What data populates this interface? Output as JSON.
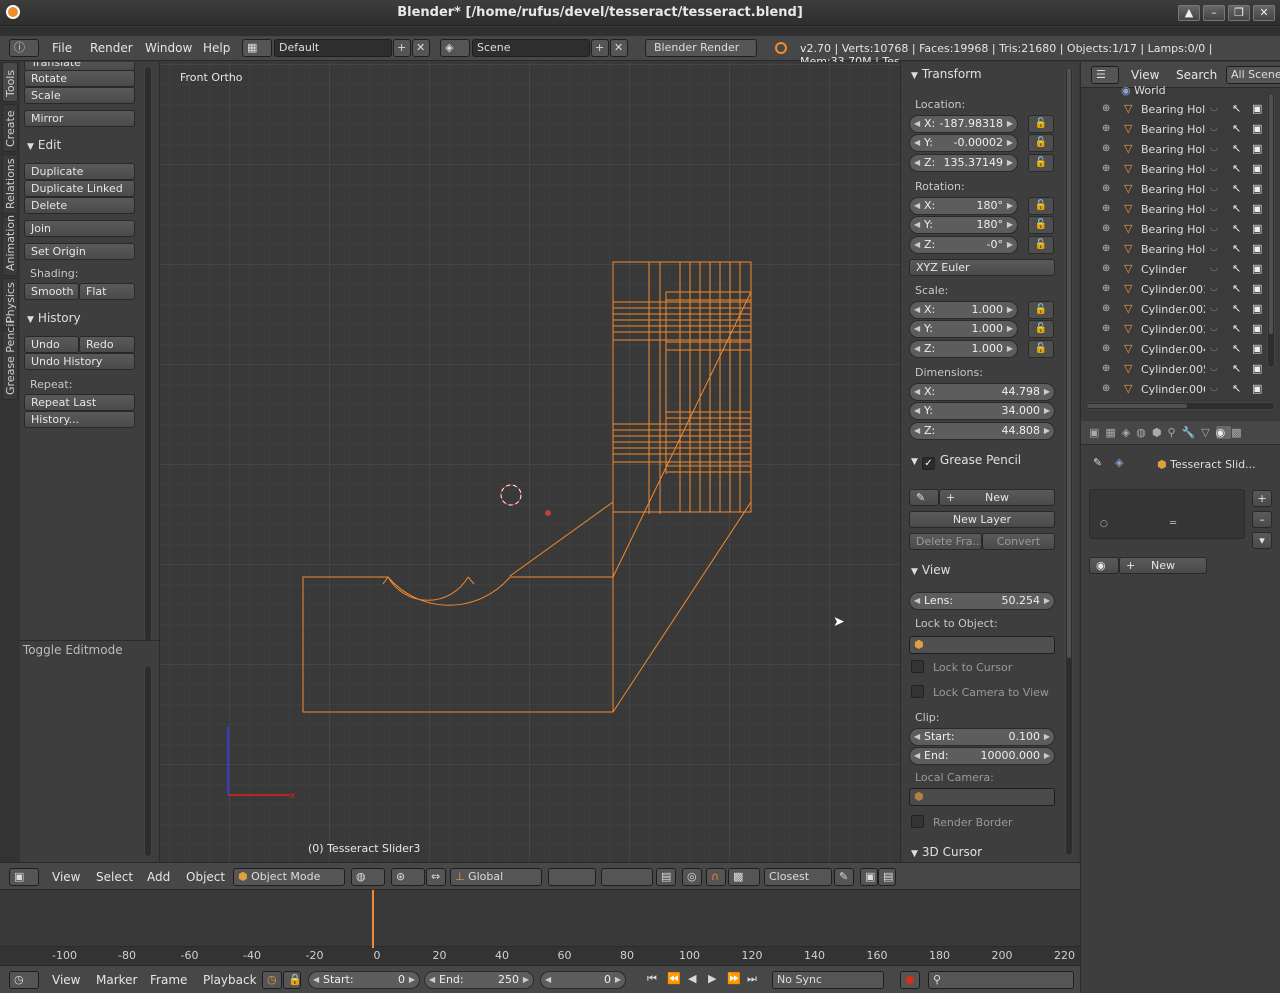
{
  "window": {
    "title": "Blender* [/home/rufus/devel/tesseract/tesseract.blend]"
  },
  "menubar": {
    "menus": [
      "File",
      "Render",
      "Window",
      "Help"
    ],
    "layout": "Default",
    "scene": "Scene",
    "engine": "Blender Render",
    "stats": "v2.70 | Verts:10768 | Faces:19968 | Tris:21680 | Objects:1/17 | Lamps:0/0 | Mem:33.70M | Tes"
  },
  "tool_tabs": [
    "Tools",
    "Create",
    "Relations",
    "Animation",
    "Physics",
    "Grease Pencil"
  ],
  "tools": {
    "partial_top": "Translate",
    "rotate": "Rotate",
    "scale": "Scale",
    "mirror": "Mirror",
    "edit_header": "Edit",
    "duplicate": "Duplicate",
    "duplicate_linked": "Duplicate Linked",
    "delete": "Delete",
    "join": "Join",
    "set_origin": "Set Origin",
    "shading_label": "Shading:",
    "smooth": "Smooth",
    "flat": "Flat",
    "history_header": "History",
    "undo": "Undo",
    "redo": "Redo",
    "undo_history": "Undo History",
    "repeat_label": "Repeat:",
    "repeat_last": "Repeat Last",
    "history": "History...",
    "toggle_editmode": "Toggle Editmode"
  },
  "viewport": {
    "view_name": "Front Ortho",
    "object_info": "(0) Tesseract Slider3"
  },
  "properties": {
    "transform_header": "Transform",
    "location_label": "Location:",
    "location": {
      "x": "-187.98318",
      "y": "-0.00002",
      "z": "135.37149"
    },
    "rotation_label": "Rotation:",
    "rotation": {
      "x": "180°",
      "y": "180°",
      "z": "-0°"
    },
    "rotation_mode": "XYZ Euler",
    "scale_label": "Scale:",
    "scale": {
      "x": "1.000",
      "y": "1.000",
      "z": "1.000"
    },
    "dimensions_label": "Dimensions:",
    "dimensions": {
      "x": "44.798",
      "y": "34.000",
      "z": "44.808"
    },
    "grease_pencil_header": "Grease Pencil",
    "gp_new": "New",
    "gp_new_layer": "New Layer",
    "gp_delete_frame": "Delete Fra...",
    "gp_convert": "Convert",
    "view_header": "View",
    "lens_label": "Lens:",
    "lens": "50.254",
    "lock_to_object": "Lock to Object:",
    "lock_to_cursor": "Lock to Cursor",
    "lock_camera": "Lock Camera to View",
    "clip_label": "Clip:",
    "clip_start_label": "Start:",
    "clip_start": "0.100",
    "clip_end_label": "End:",
    "clip_end": "10000.000",
    "local_camera": "Local Camera:",
    "render_border": "Render Border",
    "cursor_header": "3D Cursor",
    "axis_labels": {
      "x": "X:",
      "y": "Y:",
      "z": "Z:"
    }
  },
  "outliner": {
    "menus": [
      "View",
      "Search"
    ],
    "filter": "All Scenes",
    "partial_top": "World",
    "items": [
      "Bearing Holc",
      "Bearing Holc",
      "Bearing Holc",
      "Bearing Holc",
      "Bearing Holc",
      "Bearing Holc",
      "Bearing Holc",
      "Bearing Holc",
      "Cylinder",
      "Cylinder.001",
      "Cylinder.002",
      "Cylinder.003",
      "Cylinder.004",
      "Cylinder.005",
      "Cylinder.006"
    ]
  },
  "material": {
    "object_name": "Tesseract Slid...",
    "new_label": "New"
  },
  "view3d_header": {
    "menus": [
      "View",
      "Select",
      "Add",
      "Object"
    ],
    "mode": "Object Mode",
    "orientation": "Global",
    "snap_target": "Closest"
  },
  "timeline": {
    "ticks": [
      "-100",
      "-80",
      "-60",
      "-40",
      "-20",
      "0",
      "20",
      "40",
      "60",
      "80",
      "100",
      "120",
      "140",
      "160",
      "180",
      "200",
      "220"
    ],
    "current_frame": 0,
    "menus": [
      "View",
      "Marker",
      "Frame",
      "Playback"
    ],
    "start_label": "Start:",
    "start": "0",
    "end_label": "End:",
    "end": "250",
    "frame": "0",
    "sync": "No Sync"
  },
  "colors": {
    "accent": "#f28a2e",
    "selection": "#ff8c1a",
    "background": "#393939"
  }
}
